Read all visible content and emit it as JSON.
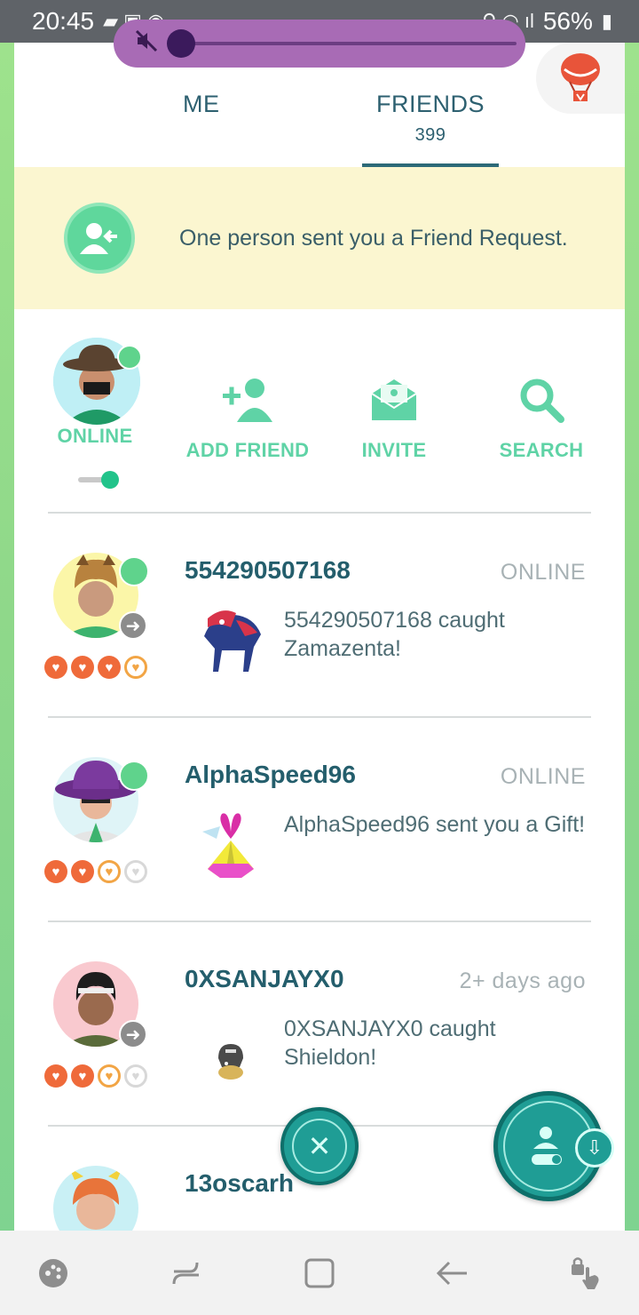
{
  "status_bar": {
    "time": "20:45",
    "battery": "56%"
  },
  "volume": {
    "level": 0.0
  },
  "tabs": {
    "me_label": "ME",
    "friends_label": "FRIENDS",
    "friends_count": "399"
  },
  "banner": {
    "text": "One person sent you a Friend Request."
  },
  "actions": {
    "online_label": "ONLINE",
    "add_friend_label": "ADD FRIEND",
    "invite_label": "INVITE",
    "search_label": "SEARCH",
    "online_toggle": true
  },
  "friends": [
    {
      "name": "554290507168",
      "status": "ONLINE",
      "activity": "554290507168 caught Zamazenta!",
      "hearts": [
        "full",
        "full",
        "full",
        "half"
      ]
    },
    {
      "name": "AlphaSpeed96",
      "status": "ONLINE",
      "activity": "AlphaSpeed96 sent you a Gift!",
      "hearts": [
        "full",
        "full",
        "half",
        "empty"
      ]
    },
    {
      "name": "0XSANJAYX0",
      "status": "2+ days ago",
      "activity": "0XSANJAYX0 caught Shieldon!",
      "hearts": [
        "full",
        "full",
        "half",
        "empty"
      ]
    },
    {
      "name": "13oscarh",
      "status": "",
      "activity": "",
      "hearts": []
    }
  ],
  "colors": {
    "accent": "#5fd3a6",
    "teal_dark": "#245e6c",
    "banner_bg": "#fbf6d0",
    "fab": "#1f9d95"
  }
}
